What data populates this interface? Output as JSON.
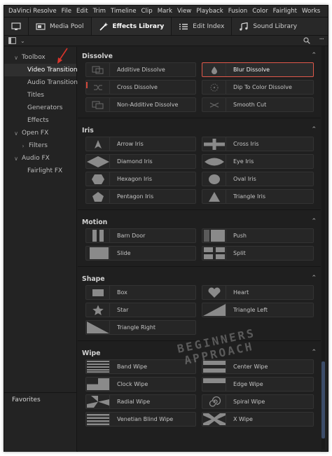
{
  "menu": [
    "DaVinci Resolve",
    "File",
    "Edit",
    "Trim",
    "Timeline",
    "Clip",
    "Mark",
    "View",
    "Playback",
    "Fusion",
    "Color",
    "Fairlight",
    "Works"
  ],
  "toolbar": {
    "media_pool": "Media Pool",
    "effects_library": "Effects Library",
    "edit_index": "Edit Index",
    "sound_library": "Sound Library"
  },
  "left_panel": {
    "toolbox": "Toolbox",
    "video_transitions": "Video Transitions",
    "audio_transitions": "Audio Transitions",
    "titles": "Titles",
    "generators": "Generators",
    "effects": "Effects",
    "open_fx": "Open FX",
    "filters": "Filters",
    "audio_fx": "Audio FX",
    "fairlight_fx": "Fairlight FX",
    "favorites": "Favorites"
  },
  "sections": {
    "dissolve": {
      "title": "Dissolve",
      "items": [
        "Additive Dissolve",
        "Blur Dissolve",
        "Cross Dissolve",
        "Dip To Color Dissolve",
        "Non-Additive Dissolve",
        "Smooth Cut"
      ]
    },
    "iris": {
      "title": "Iris",
      "items": [
        "Arrow Iris",
        "Cross Iris",
        "Diamond Iris",
        "Eye Iris",
        "Hexagon Iris",
        "Oval Iris",
        "Pentagon Iris",
        "Triangle Iris"
      ]
    },
    "motion": {
      "title": "Motion",
      "items": [
        "Barn Door",
        "Push",
        "Slide",
        "Split"
      ]
    },
    "shape": {
      "title": "Shape",
      "items": [
        "Box",
        "Heart",
        "Star",
        "Triangle Left",
        "Triangle Right"
      ]
    },
    "wipe": {
      "title": "Wipe",
      "items": [
        "Band Wipe",
        "Center Wipe",
        "Clock Wipe",
        "Edge Wipe",
        "Radial Wipe",
        "Spiral Wipe",
        "Venetian Blind Wipe",
        "X Wipe"
      ]
    }
  },
  "selected_item": "Blur Dissolve",
  "watermark": {
    "line1": "BEGINNERS",
    "line2": "APPROACH"
  },
  "colors": {
    "selection_border": "#e0584a",
    "annotation_arrow": "#d9342b",
    "scrollbar_thumb": "#3c4c68"
  }
}
